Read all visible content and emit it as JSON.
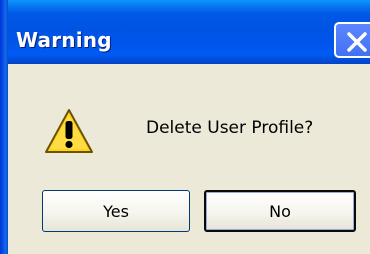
{
  "window": {
    "title": "Warning",
    "close_icon": "close-icon"
  },
  "dialog": {
    "icon": "warning-icon",
    "message": "Delete User Profile?",
    "buttons": {
      "yes_label": "Yes",
      "no_label": "No"
    }
  },
  "colors": {
    "titlebar": "#0054e3",
    "face": "#ece9d8",
    "warning_yellow": "#ffd21f"
  }
}
